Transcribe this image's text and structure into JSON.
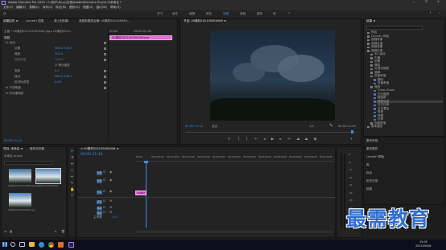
{
  "titlebar": {
    "app_icon": "premiere-pro-icon",
    "title": "Adobe Premiere Pro 2020 - C:\\用户\\Xnyy\\文档\\Adobe\\Premiere Pro\\14.0\\未命名 *"
  },
  "menus": [
    "文件(F)",
    "编辑(E)",
    "剪辑(C)",
    "序列(S)",
    "标记(M)",
    "图形(G)",
    "视图(V)",
    "窗口(W)",
    "帮助(H)"
  ],
  "workspaces": [
    {
      "label": "学习",
      "active": false
    },
    {
      "label": "组件",
      "active": false
    },
    {
      "label": "编辑",
      "active": false
    },
    {
      "label": "颜色",
      "active": false
    },
    {
      "label": "效果",
      "active": true
    },
    {
      "label": "音频",
      "active": false
    },
    {
      "label": "图形",
      "active": false
    },
    {
      "label": "库",
      "active": false
    }
  ],
  "effect_controls": {
    "tabs": [
      "效果控件 ≡",
      "Lumetri 范围",
      "源:(无剪辑)",
      "音频剪辑混合器: 00素材202105050..."
    ],
    "clip_row": "主要 * 00素材202105050006.jpg ▸ 00素材2021...",
    "video_header": "视频",
    "clip_bar_label": "00素材202105050006.jpg",
    "rows": [
      {
        "name": "fx  运动",
        "value": ""
      },
      {
        "name": "位置",
        "value": "960.0    540.0"
      },
      {
        "name": "缩放",
        "value": "100.0"
      },
      {
        "name": "缩放宽度",
        "value": "100.0"
      },
      {
        "name": "",
        "value": "☑ 等比缩放"
      },
      {
        "name": "旋转",
        "value": "0.0"
      },
      {
        "name": "锚点",
        "value": "960.0    540.0"
      },
      {
        "name": "防闪烁滤镜",
        "value": "0.00"
      },
      {
        "name": "fx  不透明度",
        "value": ""
      },
      {
        "name": "fx  时间重映射",
        "value": ""
      }
    ],
    "timecode": "00:00:11:10",
    "ruler_times": [
      "00:00",
      "00:00:05:00"
    ]
  },
  "program_monitor": {
    "tab": "节目: 00素材202105050006 ≡",
    "timecode": "00:00:11:10",
    "fit": "适合",
    "quality": "1/2",
    "duration": "00:00:11:00"
  },
  "effects_panel": {
    "tab": "效果 ≡",
    "items": [
      {
        "label": "预设",
        "indent": 0,
        "selected": false
      },
      {
        "label": "Lumetri 预设",
        "indent": 0,
        "selected": false
      },
      {
        "label": "音频效果",
        "indent": 0,
        "selected": false
      },
      {
        "label": "音频过渡",
        "indent": 0,
        "selected": false
      },
      {
        "label": "视频效果",
        "indent": 0,
        "selected": false
      },
      {
        "label": "视频过渡",
        "indent": 0,
        "selected": false
      },
      {
        "label": "3D 运动",
        "indent": 1,
        "selected": false
      },
      {
        "label": "内滑",
        "indent": 1,
        "selected": false
      },
      {
        "label": "划像",
        "indent": 1,
        "selected": false
      },
      {
        "label": "擦除",
        "indent": 1,
        "selected": false
      },
      {
        "label": "沉浸式视频",
        "indent": 1,
        "selected": false
      },
      {
        "label": "溶解",
        "indent": 1,
        "selected": false
      },
      {
        "label": "页面剥落",
        "indent": 1,
        "selected": false
      },
      {
        "label": "翻页",
        "indent": 2,
        "selected": false
      },
      {
        "label": "页面剥落",
        "indent": 2,
        "selected": false
      },
      {
        "label": "缩放",
        "indent": 1,
        "selected": false
      },
      {
        "label": "Cross Zoom",
        "indent": 2,
        "selected": false
      },
      {
        "label": "交叉缩放",
        "indent": 2,
        "selected": false
      },
      {
        "label": "缩放框",
        "indent": 2,
        "selected": false
      },
      {
        "label": "缩放轨迹",
        "indent": 2,
        "selected": true
      },
      {
        "label": "交叉拉伸",
        "indent": 2,
        "selected": false
      },
      {
        "label": "交叉叠加",
        "indent": 2,
        "selected": false
      },
      {
        "label": "堆栈",
        "indent": 2,
        "selected": false
      },
      {
        "label": "伸展",
        "indent": 2,
        "selected": false
      },
      {
        "label": "拉伸",
        "indent": 2,
        "selected": false
      },
      {
        "label": "页面剥落",
        "indent": 1,
        "selected": false
      },
      {
        "label": "基本图形",
        "indent": 0,
        "selected": false
      }
    ],
    "sections": [
      "基本声音",
      "基本图形",
      "Lumetri 颜色",
      "库",
      "标记",
      "历史记录",
      "信息"
    ]
  },
  "project_panel": {
    "tabs": [
      "项目: 未命名 ≡",
      "媒体浏览器"
    ],
    "name": "未命名.prproj",
    "clips": [
      {
        "name": "00素材202105050006.jpg",
        "duration": "5:00",
        "sky": "#3b6e9c"
      },
      {
        "name": "00素材202105050006",
        "duration": "11:00",
        "sky": "#5a86b8"
      },
      {
        "name": "00素材202105050007.jpg",
        "duration": "5:00",
        "sky": "#4a7fb5"
      }
    ]
  },
  "timeline": {
    "tab": "× 00素材202105050006 ≡",
    "timecode": "00:00:11:10",
    "ruler": [
      "00:00",
      "00:00:05:00",
      "00:00:10:00",
      "00:00:15:00",
      "00:00:20:00",
      "00:00:25:00",
      "00:00:30:00",
      "00:00:35:00",
      "00:00:40:00",
      "00:00:45:00",
      "00:00:50:00",
      "00:00:55:00",
      "00:01:00:00"
    ],
    "tracks": [
      "V3",
      "V2",
      "V1",
      "A1",
      "A2",
      "A3"
    ],
    "master": "主声道",
    "master_value": "0.0",
    "clip": "00素材",
    "audio_scale": [
      "0",
      "-6",
      "-12",
      "-18",
      "-24",
      "-30",
      "-36",
      "-42",
      "-48",
      "-54"
    ]
  },
  "taskbar": {
    "icons": [
      "windows-icon",
      "search-icon",
      "taskview-icon",
      "file-explorer-icon",
      "edge-icon",
      "chrome-icon",
      "app-icon",
      "premiere-pro-icon"
    ],
    "time": "15:05",
    "date": "2021/05/06"
  },
  "watermark": "最需教育",
  "colors": {
    "accent": "#3a8ee6",
    "clip_pink": "#e36fd6",
    "panel": "#232323",
    "bg": "#1d1d1d"
  }
}
